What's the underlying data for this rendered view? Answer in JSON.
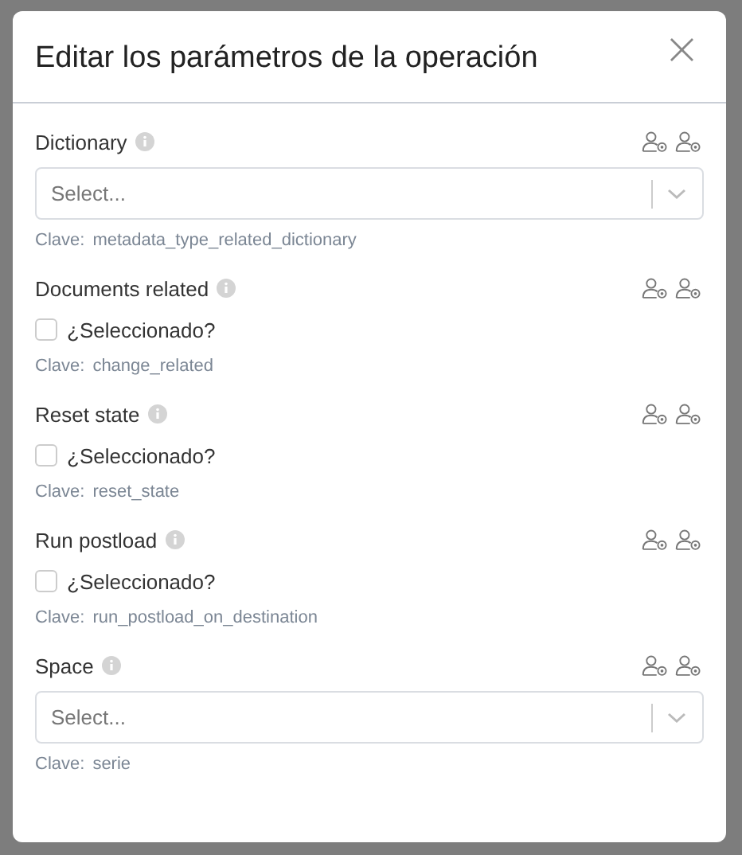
{
  "dialog": {
    "title": "Editar los parámetros de la operación",
    "close": "×",
    "fields": [
      {
        "kind": "select",
        "label": "Dictionary",
        "placeholder": "Select...",
        "key_label": "Clave:",
        "key": "metadata_type_related_dictionary"
      },
      {
        "kind": "checkbox",
        "label": "Documents related",
        "option": "¿Seleccionado?",
        "checked": false,
        "key_label": "Clave:",
        "key": "change_related"
      },
      {
        "kind": "checkbox",
        "label": "Reset state",
        "option": "¿Seleccionado?",
        "checked": false,
        "key_label": "Clave:",
        "key": "reset_state"
      },
      {
        "kind": "checkbox",
        "label": "Run postload",
        "option": "¿Seleccionado?",
        "checked": false,
        "key_label": "Clave:",
        "key": "run_postload_on_destination"
      },
      {
        "kind": "select",
        "label": "Space",
        "placeholder": "Select...",
        "key_label": "Clave:",
        "key": "serie"
      }
    ]
  }
}
